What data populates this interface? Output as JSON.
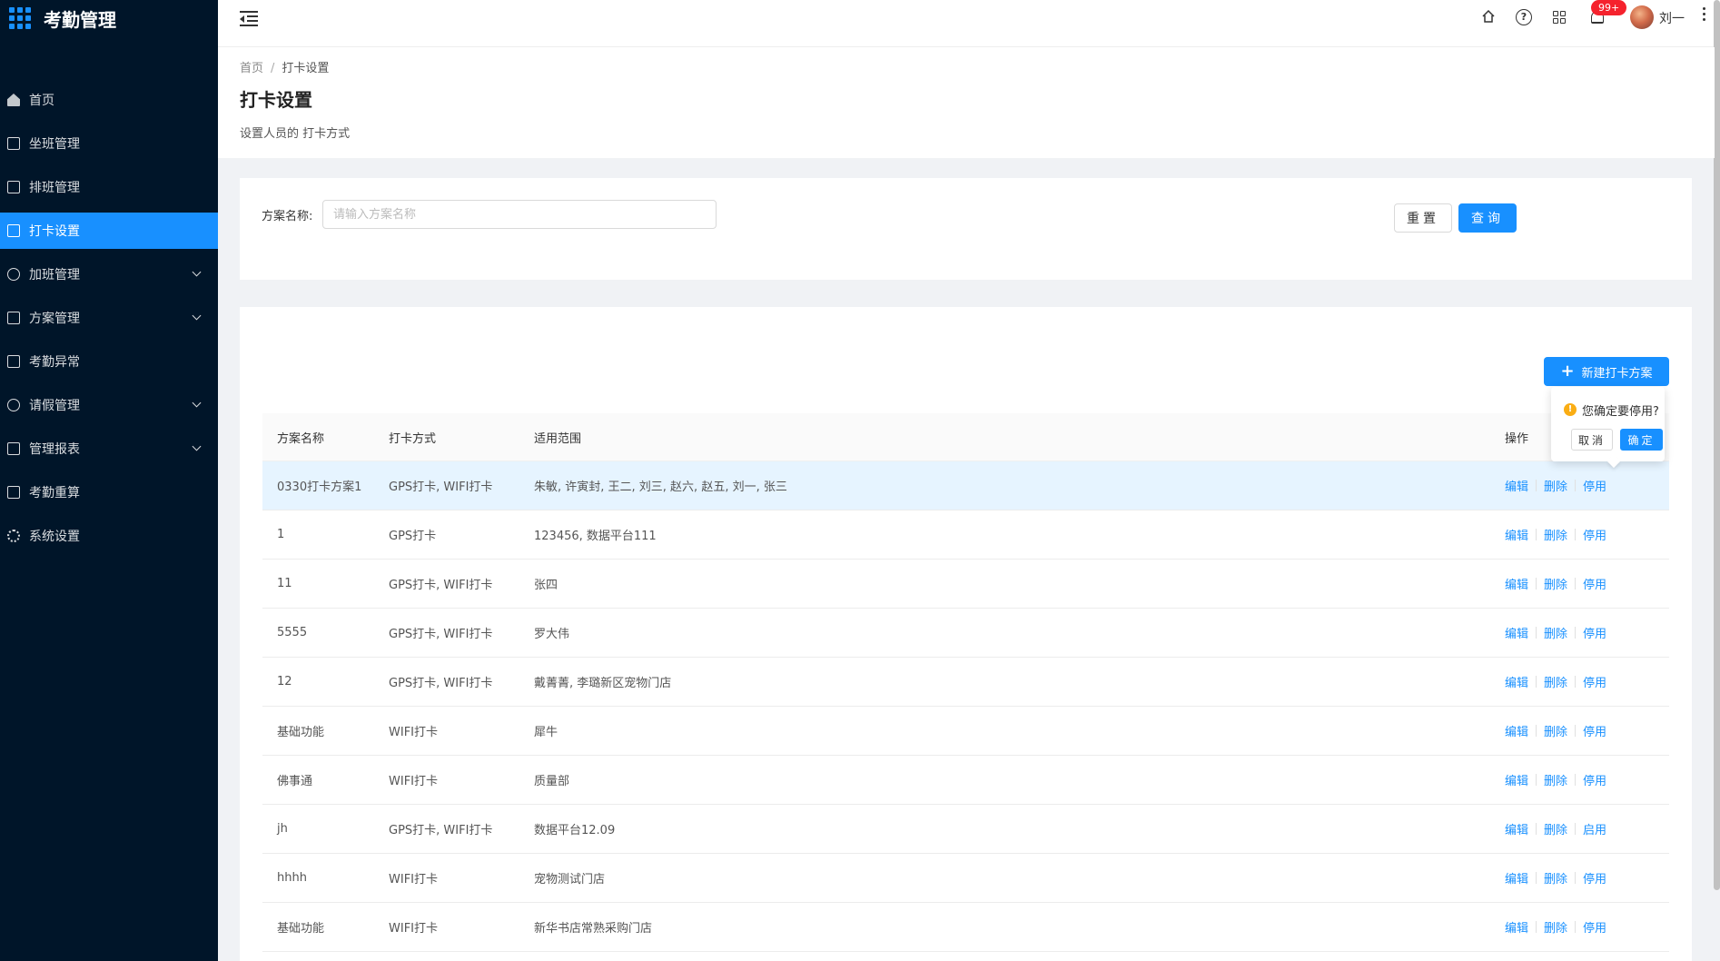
{
  "app": {
    "title": "考勤管理"
  },
  "colors": {
    "sidebar_bg": "#001529",
    "primary": "#1890ff",
    "badge": "#f5222d",
    "warning": "#faad14"
  },
  "sidebar": {
    "items": [
      {
        "label": "首页",
        "icon": "home-icon",
        "active": false,
        "has_submenu": false
      },
      {
        "label": "坐班管理",
        "icon": "calendar-check-icon",
        "active": false,
        "has_submenu": false
      },
      {
        "label": "排班管理",
        "icon": "schedule-icon",
        "active": false,
        "has_submenu": false
      },
      {
        "label": "打卡设置",
        "icon": "edit-icon",
        "active": true,
        "has_submenu": false
      },
      {
        "label": "加班管理",
        "icon": "clock-icon",
        "active": false,
        "has_submenu": true
      },
      {
        "label": "方案管理",
        "icon": "document-icon",
        "active": false,
        "has_submenu": true
      },
      {
        "label": "考勤异常",
        "icon": "alert-icon",
        "active": false,
        "has_submenu": false
      },
      {
        "label": "请假管理",
        "icon": "leave-icon",
        "active": false,
        "has_submenu": true
      },
      {
        "label": "管理报表",
        "icon": "report-icon",
        "active": false,
        "has_submenu": true
      },
      {
        "label": "考勤重算",
        "icon": "calculator-icon",
        "active": false,
        "has_submenu": false
      },
      {
        "label": "系统设置",
        "icon": "gear-icon",
        "active": false,
        "has_submenu": false
      }
    ]
  },
  "header": {
    "notification_badge": "99+",
    "username": "刘一"
  },
  "breadcrumb": {
    "home": "首页",
    "current": "打卡设置"
  },
  "page": {
    "title": "打卡设置",
    "description": "设置人员的 打卡方式"
  },
  "search": {
    "label": "方案名称:",
    "placeholder": "请输入方案名称",
    "value": "",
    "reset_label": "重置",
    "query_label": "查询"
  },
  "table": {
    "new_button_label": "新建打卡方案",
    "columns": [
      "方案名称",
      "打卡方式",
      "适用范围",
      "操作"
    ],
    "rows": [
      {
        "name": "0330打卡方案1",
        "method": "GPS打卡, WIFI打卡",
        "scope": "朱敏, 许寅封, 王二, 刘三, 赵六, 赵五, 刘一, 张三",
        "toggle": "停用"
      },
      {
        "name": "1",
        "method": "GPS打卡",
        "scope": "123456, 数据平台111",
        "toggle": "停用"
      },
      {
        "name": "11",
        "method": "GPS打卡, WIFI打卡",
        "scope": "张四",
        "toggle": "停用"
      },
      {
        "name": "5555",
        "method": "GPS打卡, WIFI打卡",
        "scope": "罗大伟",
        "toggle": "停用"
      },
      {
        "name": "12",
        "method": "GPS打卡, WIFI打卡",
        "scope": "戴菁菁, 李璐新区宠物门店",
        "toggle": "停用"
      },
      {
        "name": "基础功能",
        "method": "WIFI打卡",
        "scope": "犀牛",
        "toggle": "停用"
      },
      {
        "name": "佛事通",
        "method": "WIFI打卡",
        "scope": "质量部",
        "toggle": "停用"
      },
      {
        "name": "jh",
        "method": "GPS打卡, WIFI打卡",
        "scope": "数据平台12.09",
        "toggle": "启用"
      },
      {
        "name": "hhhh",
        "method": "WIFI打卡",
        "scope": "宠物测试门店",
        "toggle": "停用"
      },
      {
        "name": "基础功能",
        "method": "WIFI打卡",
        "scope": "新华书店常熟采购门店",
        "toggle": "停用"
      }
    ],
    "edit_label": "编辑",
    "delete_label": "删除"
  },
  "popconfirm": {
    "message": "您确定要停用?",
    "cancel_label": "取消",
    "ok_label": "确定"
  }
}
